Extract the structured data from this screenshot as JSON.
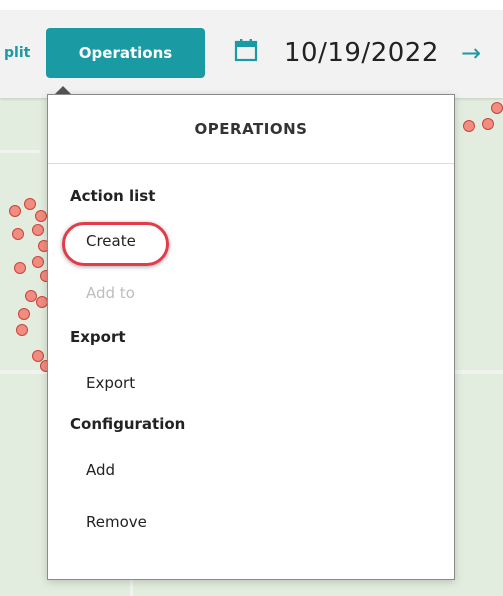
{
  "toolbar": {
    "split_label": "plit",
    "operations_button": "Operations",
    "date": "10/19/2022",
    "calendar_icon": "calendar-icon",
    "next_icon": "arrow-right-icon"
  },
  "menu": {
    "title": "OPERATIONS",
    "sections": [
      {
        "label": "Action list",
        "items": [
          {
            "label": "Create",
            "disabled": false,
            "highlighted": true
          },
          {
            "label": "Add to",
            "disabled": true
          }
        ]
      },
      {
        "label": "Export",
        "items": [
          {
            "label": "Export",
            "disabled": false
          }
        ]
      },
      {
        "label": "Configuration",
        "items": [
          {
            "label": "Add",
            "disabled": false
          },
          {
            "label": "Remove",
            "disabled": false
          }
        ]
      }
    ]
  },
  "colors": {
    "accent": "#1a9aa3",
    "marker_fill": "#f08c80",
    "marker_stroke": "#c9443a",
    "highlight": "#e23b4a"
  }
}
